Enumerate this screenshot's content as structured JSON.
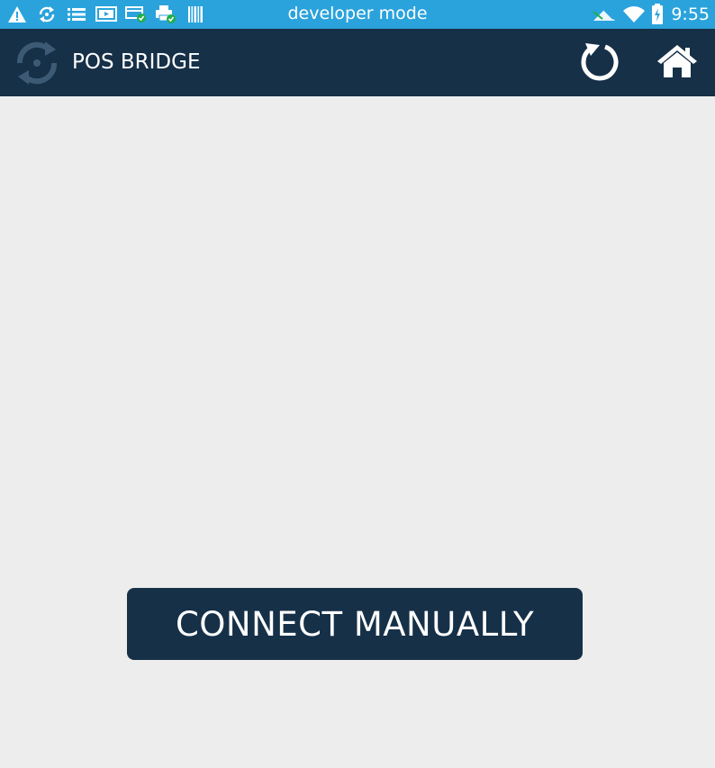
{
  "status_bar": {
    "title": "developer mode",
    "time": "9:55",
    "background_color": "#2aa3dc",
    "left_icons": [
      "warning-icon",
      "sync-icon",
      "list-icon",
      "screen-icon",
      "card-check-icon",
      "printer-check-icon",
      "barcode-icon"
    ],
    "right_icons": [
      "network-arrows-icon",
      "wifi-icon",
      "battery-charging-icon"
    ]
  },
  "app_bar": {
    "title": "POS BRIDGE",
    "background_color": "#163048",
    "logo_icon": "sync-logo-icon",
    "actions": [
      "refresh-icon",
      "home-icon"
    ]
  },
  "main": {
    "background_color": "#ededed",
    "connect_button_label": "CONNECT MANUALLY"
  }
}
